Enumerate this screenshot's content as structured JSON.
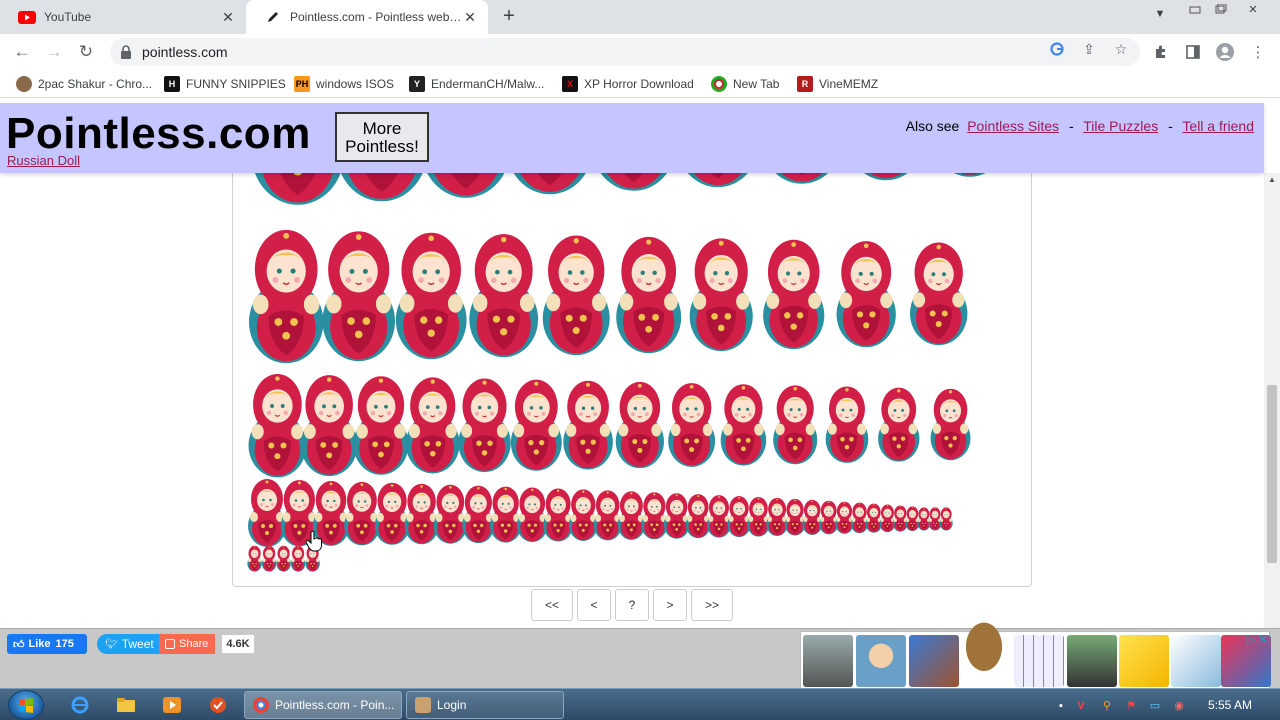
{
  "browser": {
    "tabs": [
      {
        "title": "YouTube",
        "icon": "youtube-icon",
        "active": false
      },
      {
        "title": "Pointless.com - Pointless website",
        "icon": "pencil-icon",
        "active": true
      }
    ],
    "url": "pointless.com",
    "bookmarks": [
      {
        "label": "2pac Shakur - Chro...",
        "icon": "tupac-icon"
      },
      {
        "label": "FUNNY SNIPPIES",
        "icon": "h-logo-icon"
      },
      {
        "label": "windows ISOS",
        "icon": "ph-logo-icon",
        "icon_text": "PH"
      },
      {
        "label": "EndermanCH/Malw...",
        "icon": "yp-logo-icon",
        "icon_text": "Y"
      },
      {
        "label": "XP Horror Download",
        "icon": "x-logo-icon",
        "icon_text": "X"
      },
      {
        "label": "New Tab",
        "icon": "chrome-icon"
      },
      {
        "label": "VineMEMZ",
        "icon": "r-logo-icon",
        "icon_text": "R"
      }
    ]
  },
  "site": {
    "logo": "Pointless.com",
    "more_button_line1": "More",
    "more_button_line2": "Pointless!",
    "page_link": "Russian Doll",
    "also_see_label": "Also see",
    "links": [
      "Pointless Sites",
      "Tile Puzzles",
      "Tell a friend"
    ],
    "separator": "-",
    "pager": [
      "<<",
      "<",
      "?",
      ">",
      ">>"
    ]
  },
  "social": {
    "like_label": "Like",
    "like_count": "175",
    "tweet_label": "Tweet",
    "share_label": "Share",
    "share_count": "4.6K"
  },
  "taskbar": {
    "tasks": [
      {
        "label": "Pointless.com - Poin...",
        "active": true
      },
      {
        "label": "Login",
        "active": false
      }
    ],
    "clock": "5:55 AM"
  },
  "colors": {
    "header_bg": "#c5c5ff",
    "link": "#9b1b52",
    "doll_red": "#d11f48",
    "doll_teal": "#2a8fa0"
  }
}
